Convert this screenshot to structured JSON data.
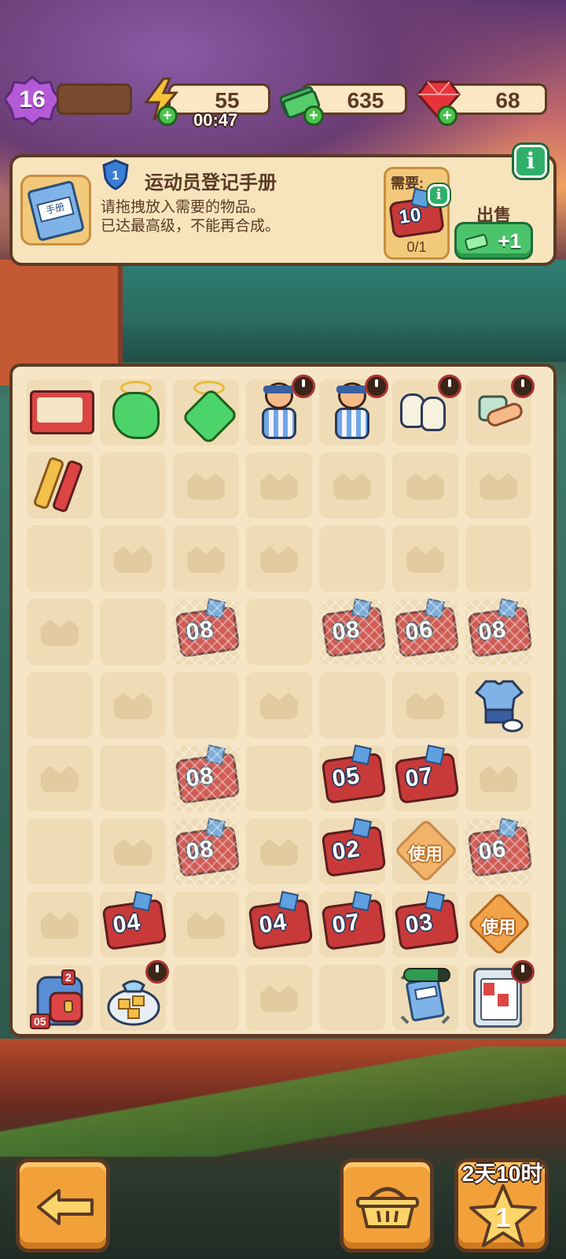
{
  "topbar": {
    "level": "16",
    "energy": "55",
    "energy_timer": "00:47",
    "cash": "635",
    "gems": "68"
  },
  "card": {
    "tier": "1",
    "title": "运动员登记手册",
    "desc": "请拖拽放入需要的物品。\n已达最高级，不能再合成。",
    "need_label": "需要:",
    "need_item": "10",
    "need_count": "0/1",
    "sell_label": "出售",
    "sell_value": "+1"
  },
  "board": {
    "use_label": "使用",
    "tickets": {
      "r4c3": "08",
      "r4c5": "08",
      "r4c6": "06",
      "r4c7": "08",
      "r6c3": "08",
      "r6c5": "05",
      "r6c6": "07",
      "r7c3": "08",
      "r7c5": "02",
      "r7c7": "06",
      "r8c2": "04",
      "r8c4": "04",
      "r8c5": "07",
      "r8c6": "03"
    },
    "backpack_tag_top": "2",
    "backpack_tag_bottom": "05",
    "generator_progress": 0.75
  },
  "bottom": {
    "event_timer": "2天10时",
    "star_count": "1"
  },
  "colors": {
    "board_bg": "#f6e6c6",
    "outline": "#5c3a24",
    "ticket_red": "#c83a3a",
    "button_orange": "#f2a13a",
    "green_button": "#4cc46c"
  }
}
